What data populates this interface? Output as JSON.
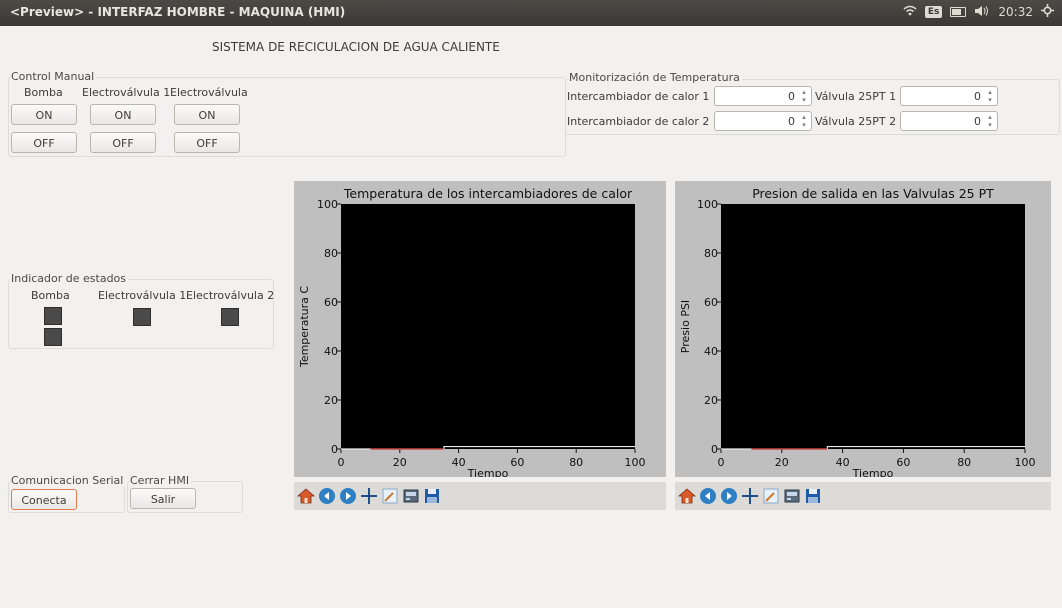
{
  "window": {
    "title": "<Preview> - INTERFAZ HOMBRE - MAQUINA (HMI)",
    "keyboard": "Es",
    "time": "20:32"
  },
  "header": {
    "title": "SISTEMA DE RECICULACION DE AGUA CALIENTE"
  },
  "control_manual": {
    "title": "Control Manual",
    "columns": [
      "Bomba",
      "Electroválvula 1",
      "Electroválvula"
    ],
    "on_label": "ON",
    "off_label": "OFF"
  },
  "monitor": {
    "title": "Monitorización de Temperatura",
    "rows": [
      {
        "label": "Intercambiador de calor 1",
        "value": "0",
        "valve_label": "Válvula 25PT 1",
        "valve_value": "0"
      },
      {
        "label": "Intercambiador de calor 2",
        "value": "0",
        "valve_label": "Válvula 25PT 2",
        "valve_value": "0"
      }
    ]
  },
  "indicators": {
    "title": "Indicador de estados",
    "columns": [
      "Bomba",
      "Electroválvula 1",
      "Electroválvula 2"
    ]
  },
  "serial": {
    "title": "Comunicacion Serial",
    "button": "Conecta"
  },
  "close": {
    "title": "Cerrar HMI",
    "button": "Salir"
  },
  "chart_data": [
    {
      "type": "line",
      "title": "Temperatura de los intercambiadores de calor",
      "xlabel": "Tiempo",
      "ylabel": "Temperatura  C",
      "xlim": [
        0,
        100
      ],
      "ylim": [
        0,
        100
      ],
      "xticks": [
        "0",
        "20",
        "40",
        "60",
        "80",
        "100"
      ],
      "yticks": [
        "0",
        "20",
        "40",
        "60",
        "80",
        "100"
      ],
      "series": [
        {
          "color": "#e8e8e8",
          "x": [
            0,
            10,
            10,
            35,
            35,
            100
          ],
          "y": [
            0,
            0,
            0,
            0,
            1,
            1
          ]
        },
        {
          "color": "#cc3333",
          "x": [
            10,
            35
          ],
          "y": [
            0,
            0
          ]
        }
      ]
    },
    {
      "type": "line",
      "title": "Presion de salida en las Valvulas 25 PT",
      "xlabel": "Tiempo",
      "ylabel": "Presio  PSI",
      "xlim": [
        0,
        100
      ],
      "ylim": [
        0,
        100
      ],
      "xticks": [
        "0",
        "20",
        "40",
        "60",
        "80",
        "100"
      ],
      "yticks": [
        "0",
        "20",
        "40",
        "60",
        "80",
        "100"
      ],
      "series": [
        {
          "color": "#e8e8e8",
          "x": [
            0,
            10,
            10,
            35,
            35,
            100
          ],
          "y": [
            0,
            0,
            0,
            0,
            1,
            1
          ]
        },
        {
          "color": "#cc3333",
          "x": [
            10,
            35
          ],
          "y": [
            0,
            0
          ]
        }
      ]
    }
  ],
  "plot_toolbar_icons": [
    "home-icon",
    "back-icon",
    "forward-icon",
    "pan-icon",
    "zoom-icon",
    "configure-icon",
    "save-icon"
  ]
}
